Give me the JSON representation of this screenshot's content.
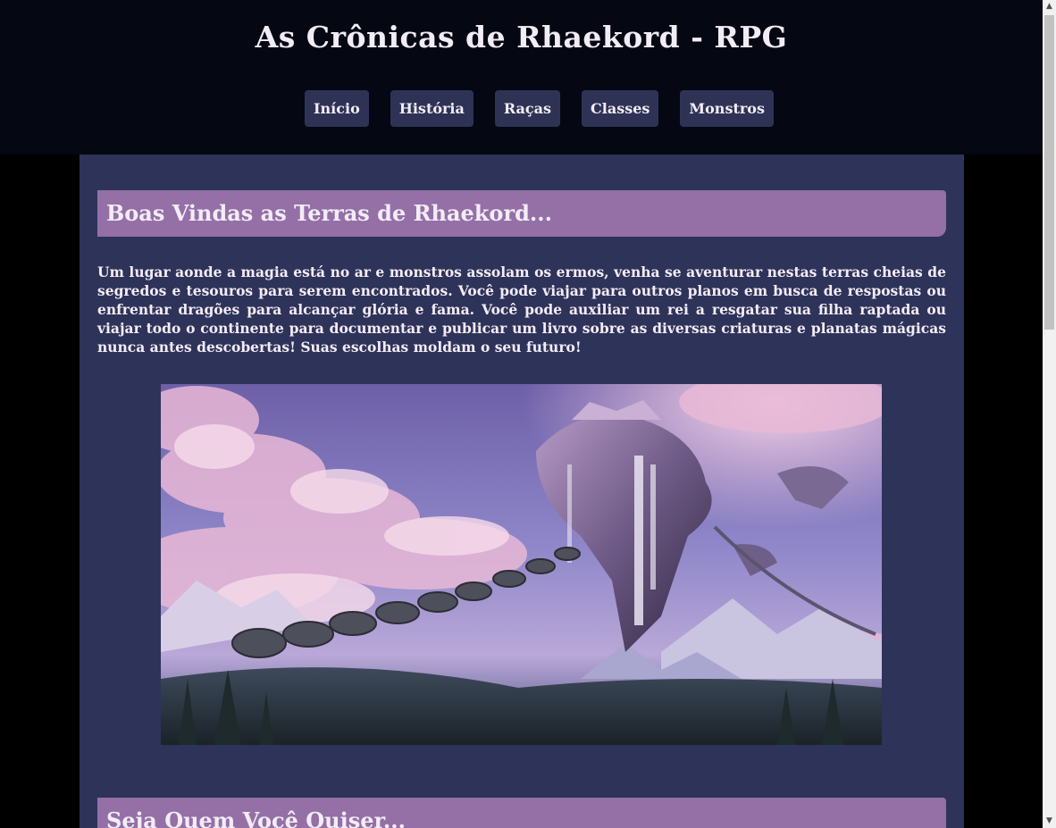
{
  "site": {
    "title": "As Crônicas de Rhaekord - RPG"
  },
  "nav": {
    "items": [
      {
        "label": "Início"
      },
      {
        "label": "História"
      },
      {
        "label": "Raças"
      },
      {
        "label": "Classes"
      },
      {
        "label": "Monstros"
      }
    ]
  },
  "main": {
    "welcome_heading": "Boas Vindas as Terras de Rhaekord...",
    "intro_text": "Um lugar aonde a magia está no ar e monstros assolam os ermos, venha se aventurar nestas terras cheias de segredos e tesouros para serem encontrados. Você pode viajar para outros planos em busca de respostas ou enfrentar dragões para alcançar glória e fama. Você pode auxiliar um rei a resgatar sua filha raptada ou viajar todo o continente para documentar e publicar um livro sobre as diversas criaturas e planatas mágicas nunca antes descobertas! Suas escolhas moldam o seu futuro!",
    "second_heading": "Seja Quem Você Quiser..."
  },
  "colors": {
    "header_bg": "#050812",
    "content_bg": "#2e3359",
    "heading_bg": "#9470a7",
    "nav_button_bg": "#2e3356",
    "text": "#f3ecf6"
  },
  "icons": {
    "scroll_up": "scroll-up-arrow-icon",
    "scroll_down": "scroll-down-arrow-icon"
  }
}
